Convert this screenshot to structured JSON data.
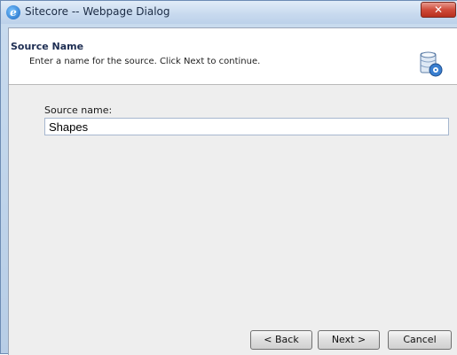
{
  "window": {
    "title": "Sitecore -- Webpage Dialog",
    "close_label": "✕"
  },
  "icons": {
    "title_icon": "internet-explorer-icon",
    "header_icon": "database-source-icon",
    "close_icon": "close-icon"
  },
  "header": {
    "title": "Source Name",
    "description": "Enter a name for the source. Click Next to continue."
  },
  "form": {
    "source_name_label": "Source name:",
    "source_name_value": "Shapes"
  },
  "buttons": {
    "back": "< Back",
    "next": "Next >",
    "cancel": "Cancel"
  },
  "colors": {
    "close_button": "#cf4b3a",
    "header_title": "#1d2d52"
  }
}
